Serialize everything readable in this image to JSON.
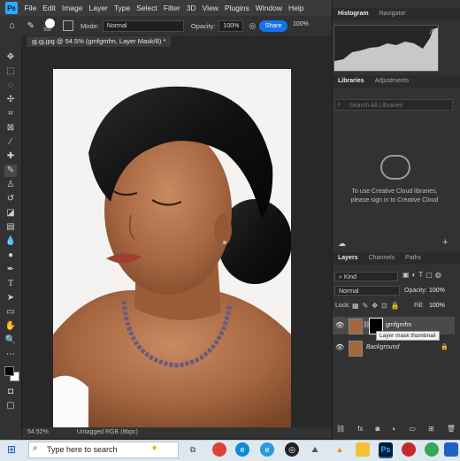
{
  "menu": {
    "items": [
      "File",
      "Edit",
      "Image",
      "Layer",
      "Type",
      "Select",
      "Filter",
      "3D",
      "View",
      "Plugins",
      "Window",
      "Help"
    ]
  },
  "options_bar": {
    "brush_size": "392",
    "mode_label": "Mode:",
    "mode_value": "Normal",
    "opacity_label": "Opacity:",
    "opacity_value": "100%",
    "flow_value": "100%",
    "share_label": "Share"
  },
  "document": {
    "tab_title": "gj.gj.jpg @ 54.5% (gmfgmfm, Layer Mask/8) *",
    "zoom": "54.52%",
    "status_info": "Untagged RGB (8bpc)"
  },
  "panels": {
    "top_tabs": [
      "Histogram",
      "Navigator"
    ],
    "mid_tabs": [
      "Libraries",
      "Adjustments"
    ],
    "library_search_placeholder": "Search All Libraries",
    "library_message_1": "To use Creative Cloud libraries,",
    "library_message_2": "please sign in to Creative Cloud",
    "layers_tabs": [
      "Layers",
      "Channels",
      "Paths"
    ]
  },
  "layers": {
    "filter_kind": "Kind",
    "blend_mode": "Normal",
    "opacity_label": "Opacity:",
    "opacity_value": "100%",
    "lock_label": "Lock:",
    "fill_label": "Fill:",
    "fill_value": "100%",
    "items": [
      {
        "name": "gmfgmfm",
        "selected": true
      },
      {
        "name": "Background",
        "selected": false
      }
    ],
    "tooltip": "Layer mask thumbnail"
  },
  "taskbar": {
    "search_placeholder": "Type here to search",
    "app_icons": [
      "task-view",
      "chrome",
      "edge",
      "edge-2",
      "app-dark",
      "app-cones",
      "vlc",
      "file-explorer",
      "photoshop",
      "app-red",
      "chrome-2",
      "app-blue"
    ]
  },
  "colors": {
    "accent": "#1473e6",
    "ps_blue": "#31a8ff"
  }
}
